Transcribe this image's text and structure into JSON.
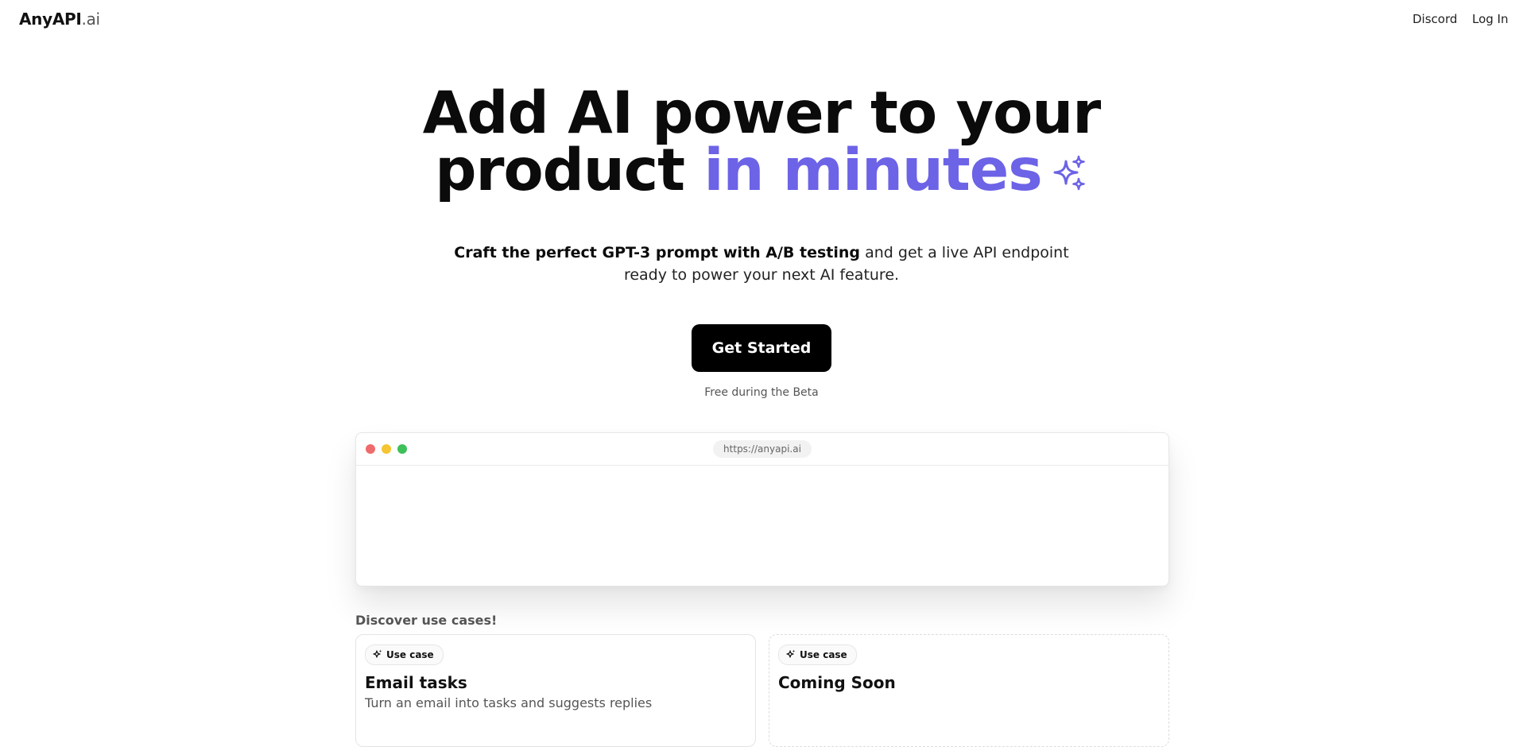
{
  "nav": {
    "logo_main": "AnyAPI",
    "logo_suffix": ".ai",
    "discord": "Discord",
    "login": "Log In"
  },
  "hero": {
    "title_line1": "Add AI power to your",
    "title_line2": "product",
    "title_accent": "in minutes",
    "sparkle_icon": "sparkles-icon",
    "subtitle_bold": "Craft the perfect GPT-3 prompt with A/B testing",
    "subtitle_rest": "and get a live API endpoint ready to power your next AI feature.",
    "cta": "Get Started",
    "cta_note": "Free during the Beta"
  },
  "browser": {
    "url": "https://anyapi.ai"
  },
  "use_cases": {
    "label": "Discover use cases!",
    "cards": [
      {
        "badge": "Use case",
        "title": "Email tasks",
        "description": "Turn an email into tasks and suggests replies"
      },
      {
        "badge": "Use case",
        "title": "Coming Soon",
        "description": ""
      }
    ]
  },
  "colors": {
    "accent": "#6c63e6",
    "cta_background": "#000000",
    "dot_red": "#ef6b6b",
    "dot_yellow": "#f5c532",
    "dot_green": "#3ec05a"
  }
}
